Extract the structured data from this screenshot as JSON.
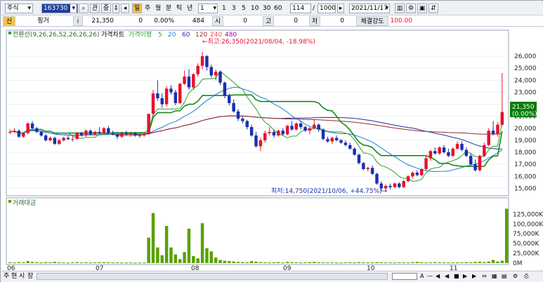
{
  "toolbar": {
    "market_select": "주식",
    "code": "163730",
    "icon_label_1": "관",
    "icon_label_2": "중",
    "period_badge": "일",
    "period_tabs": [
      "주",
      "월",
      "분",
      "틱",
      "년"
    ],
    "interval_select": "1",
    "interval_quick": [
      "1",
      "3",
      "5",
      "10",
      "30",
      "60"
    ],
    "view_count": "114",
    "total_count": "1000",
    "date": "2021/11/17"
  },
  "quote": {
    "badge": "신",
    "name": "핑거",
    "info_badge": "i",
    "price": "21,350",
    "change": "0",
    "change_rate": "0.00%",
    "volume": "484",
    "open_label": "시",
    "open": "0",
    "high_label": "고",
    "high": "0",
    "low_label": "저",
    "low": "0",
    "strength_label": "체결강도",
    "strength": "100.00"
  },
  "legend": {
    "ichimoku": "전환선(9,26,26,52,26,26,26)",
    "price_chart": "가격차트",
    "ma_label": "가격이평",
    "ma_periods": [
      "5",
      "20",
      "60",
      "120",
      "240",
      "480"
    ]
  },
  "colors": {
    "up": "#e8112d",
    "down": "#1a2fb0",
    "ma5": "#2ea12e",
    "ma20": "#1a7fd6",
    "ma60": "#1f2fa0",
    "ma120": "#9b2a2a",
    "ma240": "#e05050",
    "ma480": "#a000a0",
    "volume": "#5aa000",
    "price_box": "#0a7a0a"
  },
  "annotations": {
    "high": "←최고:26,350(2021/08/04, -18.98%)",
    "low": "최저:14,750(2021/10/06, +44.75%)→"
  },
  "current_price_box": {
    "price": "21,350",
    "rate": "(0.00%)"
  },
  "volume_legend": "거래대금",
  "axes": {
    "price_ticks": [
      "26,000",
      "25,000",
      "24,000",
      "23,000",
      "22,000",
      "21,000",
      "20,000",
      "19,000",
      "18,000",
      "17,000",
      "16,000",
      "15,000"
    ],
    "volume_ticks": [
      "125,000K",
      "100,000K",
      "75,000K",
      "50,000K",
      "25,000K",
      "0M"
    ],
    "months": [
      "06",
      "07",
      "08",
      "09",
      "10",
      "11"
    ]
  },
  "bottom_tabs": [
    "주",
    "현",
    "시",
    "장"
  ],
  "chart_data": {
    "type": "candlestick",
    "price_range": [
      14500,
      27000
    ],
    "candles": [
      [
        19700,
        19900,
        19500,
        19700
      ],
      [
        19700,
        20000,
        19600,
        19800
      ],
      [
        19800,
        19900,
        19200,
        19300
      ],
      [
        19300,
        19700,
        19200,
        19600
      ],
      [
        19600,
        20500,
        19500,
        20400
      ],
      [
        20400,
        20600,
        19900,
        20000
      ],
      [
        20000,
        20100,
        19600,
        19700
      ],
      [
        19700,
        19800,
        19300,
        19400
      ],
      [
        19400,
        19500,
        18900,
        19000
      ],
      [
        19000,
        19300,
        18900,
        19200
      ],
      [
        19200,
        19300,
        18600,
        18700
      ],
      [
        18700,
        19100,
        18600,
        19000
      ],
      [
        19000,
        19300,
        18900,
        19200
      ],
      [
        19200,
        19400,
        19000,
        19100
      ],
      [
        19100,
        19300,
        18900,
        19100
      ],
      [
        19100,
        19700,
        19100,
        19600
      ],
      [
        19600,
        19700,
        19300,
        19400
      ],
      [
        19400,
        19900,
        19300,
        19800
      ],
      [
        19800,
        19900,
        19400,
        19500
      ],
      [
        19500,
        19800,
        19400,
        19700
      ],
      [
        19700,
        20100,
        19500,
        19600
      ],
      [
        19600,
        20100,
        19500,
        20000
      ],
      [
        20000,
        20200,
        19500,
        19600
      ],
      [
        19600,
        19800,
        19400,
        19500
      ],
      [
        19500,
        19600,
        19100,
        19300
      ],
      [
        19300,
        19700,
        19200,
        19600
      ],
      [
        19600,
        19800,
        19400,
        19500
      ],
      [
        19500,
        19700,
        19300,
        19600
      ],
      [
        19600,
        19700,
        19300,
        19400
      ],
      [
        19400,
        19600,
        19200,
        19400
      ],
      [
        19400,
        19600,
        19300,
        19500
      ],
      [
        19500,
        20600,
        19500,
        21200
      ],
      [
        21200,
        23200,
        21000,
        22900
      ],
      [
        22900,
        24000,
        22300,
        22500
      ],
      [
        22500,
        22900,
        21700,
        22000
      ],
      [
        22000,
        23500,
        21800,
        23300
      ],
      [
        23300,
        23600,
        22800,
        23000
      ],
      [
        23000,
        23200,
        21900,
        22100
      ],
      [
        22100,
        23800,
        22000,
        23700
      ],
      [
        23700,
        24800,
        23600,
        24300
      ],
      [
        24300,
        24900,
        23200,
        23400
      ],
      [
        23400,
        24600,
        23200,
        24500
      ],
      [
        24500,
        25400,
        24300,
        25200
      ],
      [
        25200,
        26350,
        24900,
        26000
      ],
      [
        26000,
        26100,
        24800,
        25100
      ],
      [
        25100,
        25300,
        24200,
        24400
      ],
      [
        24400,
        24900,
        24000,
        24700
      ],
      [
        24700,
        24800,
        23600,
        23800
      ],
      [
        23800,
        23900,
        22500,
        22700
      ],
      [
        22700,
        22900,
        21900,
        22100
      ],
      [
        22100,
        22400,
        21300,
        21400
      ],
      [
        21400,
        21600,
        20600,
        20800
      ],
      [
        20800,
        21000,
        20400,
        20600
      ],
      [
        20600,
        20700,
        19900,
        20100
      ],
      [
        20100,
        20300,
        19300,
        19400
      ],
      [
        19400,
        19700,
        18400,
        18500
      ],
      [
        18500,
        19200,
        18100,
        19000
      ],
      [
        19000,
        19800,
        18800,
        19600
      ],
      [
        19600,
        20100,
        19400,
        19700
      ],
      [
        19700,
        19900,
        19200,
        19400
      ],
      [
        19400,
        19900,
        19300,
        19800
      ],
      [
        19800,
        20000,
        19400,
        19500
      ],
      [
        19500,
        20300,
        19400,
        20200
      ],
      [
        20200,
        20600,
        19800,
        19900
      ],
      [
        19900,
        20500,
        19800,
        20400
      ],
      [
        20400,
        20600,
        19900,
        20100
      ],
      [
        20100,
        20200,
        19700,
        19800
      ],
      [
        19800,
        20100,
        19500,
        20000
      ],
      [
        20000,
        20700,
        19900,
        20300
      ],
      [
        20300,
        20400,
        19700,
        19900
      ],
      [
        19900,
        20000,
        19000,
        19100
      ],
      [
        19100,
        19300,
        18800,
        18900
      ],
      [
        18900,
        19300,
        18700,
        19200
      ],
      [
        19200,
        19400,
        18900,
        19000
      ],
      [
        19000,
        19100,
        18700,
        18800
      ],
      [
        18800,
        19000,
        18500,
        18600
      ],
      [
        18600,
        18800,
        18200,
        18300
      ],
      [
        18300,
        18400,
        17700,
        17800
      ],
      [
        17800,
        17900,
        17000,
        17100
      ],
      [
        17100,
        17200,
        16500,
        16600
      ],
      [
        16600,
        16800,
        16400,
        16700
      ],
      [
        16700,
        16900,
        16100,
        16200
      ],
      [
        16200,
        16300,
        15300,
        15400
      ],
      [
        15400,
        15600,
        14750,
        15000
      ],
      [
        15000,
        15300,
        14800,
        15200
      ],
      [
        15200,
        15400,
        14900,
        15100
      ],
      [
        15100,
        15500,
        15000,
        15400
      ],
      [
        15400,
        15500,
        15000,
        15100
      ],
      [
        15100,
        15700,
        15000,
        15600
      ],
      [
        15600,
        16100,
        15500,
        16000
      ],
      [
        16000,
        16400,
        15800,
        16300
      ],
      [
        16300,
        16500,
        16000,
        16100
      ],
      [
        16100,
        16700,
        16000,
        16600
      ],
      [
        16600,
        17700,
        16500,
        17500
      ],
      [
        17500,
        18200,
        17300,
        18100
      ],
      [
        18100,
        18400,
        17800,
        17900
      ],
      [
        17900,
        18500,
        17800,
        18400
      ],
      [
        18400,
        18600,
        17900,
        18000
      ],
      [
        18000,
        18300,
        17600,
        17700
      ],
      [
        17700,
        18400,
        17600,
        18300
      ],
      [
        18300,
        18900,
        18200,
        18700
      ],
      [
        18700,
        18900,
        18100,
        18200
      ],
      [
        18200,
        18400,
        17600,
        17700
      ],
      [
        17700,
        17900,
        16900,
        17000
      ],
      [
        17000,
        17400,
        16400,
        16500
      ],
      [
        16500,
        17800,
        16400,
        17700
      ],
      [
        17700,
        18800,
        17600,
        18600
      ],
      [
        18600,
        20000,
        18500,
        19800
      ],
      [
        19800,
        20600,
        19400,
        19500
      ],
      [
        19500,
        20500,
        19300,
        20300
      ],
      [
        20300,
        24600,
        20200,
        21350
      ]
    ],
    "volume_k": [
      2000,
      1500,
      2500,
      1800,
      5000,
      3000,
      2000,
      1500,
      2500,
      1800,
      3000,
      2000,
      1500,
      1200,
      1800,
      2500,
      1500,
      2000,
      1500,
      1800,
      2200,
      2500,
      2000,
      1500,
      1800,
      1500,
      1200,
      1500,
      1000,
      1200,
      1500,
      65000,
      128000,
      40000,
      20000,
      95000,
      40000,
      22000,
      10000,
      28000,
      88000,
      18000,
      12000,
      102000,
      38000,
      30000,
      14000,
      8000,
      6000,
      5000,
      4000,
      3000,
      2500,
      2000,
      5000,
      3500,
      2500,
      2000,
      1500,
      2000,
      2500,
      1500,
      3000,
      2500,
      2000,
      1500,
      1800,
      2500,
      3000,
      2000,
      2000,
      1500,
      1800,
      1500,
      1200,
      1800,
      2000,
      1500,
      2500,
      2000,
      1500,
      2000,
      2500,
      2000,
      1800,
      1500,
      1500,
      1800,
      2000,
      1500,
      2500,
      3000,
      2000,
      1500,
      1800,
      2500,
      1800,
      2000,
      1500,
      1800,
      1500,
      2000,
      2500,
      2000,
      3000,
      3500,
      2500,
      4000,
      8000,
      4000,
      6000,
      139000
    ]
  }
}
